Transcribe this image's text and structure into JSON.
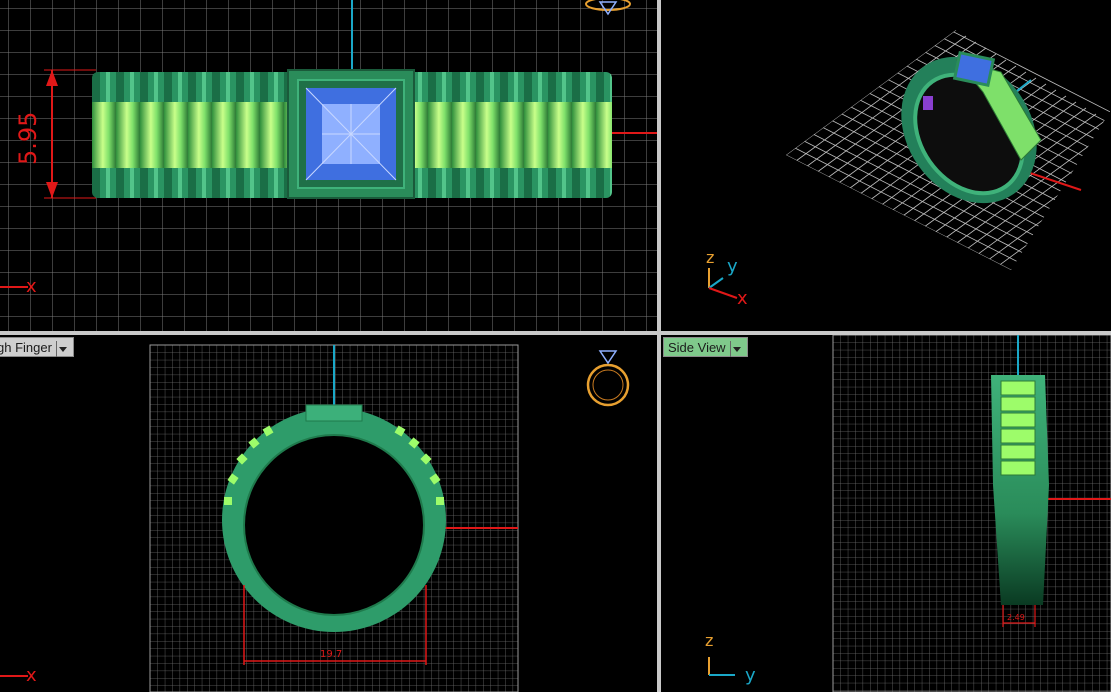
{
  "viewports": {
    "top": {
      "dimension": "5.95",
      "axis_x": "x"
    },
    "perspective": {
      "axis_z": "z",
      "axis_y": "y",
      "axis_x": "x"
    },
    "front": {
      "label": "gh Finger",
      "dimension": "19.7",
      "axis_x": "x"
    },
    "side": {
      "label": "Side View",
      "dimension": "2.49",
      "axis_z": "z",
      "axis_y": "y"
    }
  },
  "colors": {
    "grid": "#8a8a8a",
    "axis_red": "#e01818",
    "axis_cyan": "#1aa8c8",
    "ring_green": "#2e9c6a",
    "band_light": "#9dfc6a",
    "gem_blue": "#5b86f0",
    "dimension_red": "#e01818",
    "label_orange": "#e8a030"
  },
  "icons": [
    "ring-icon"
  ]
}
